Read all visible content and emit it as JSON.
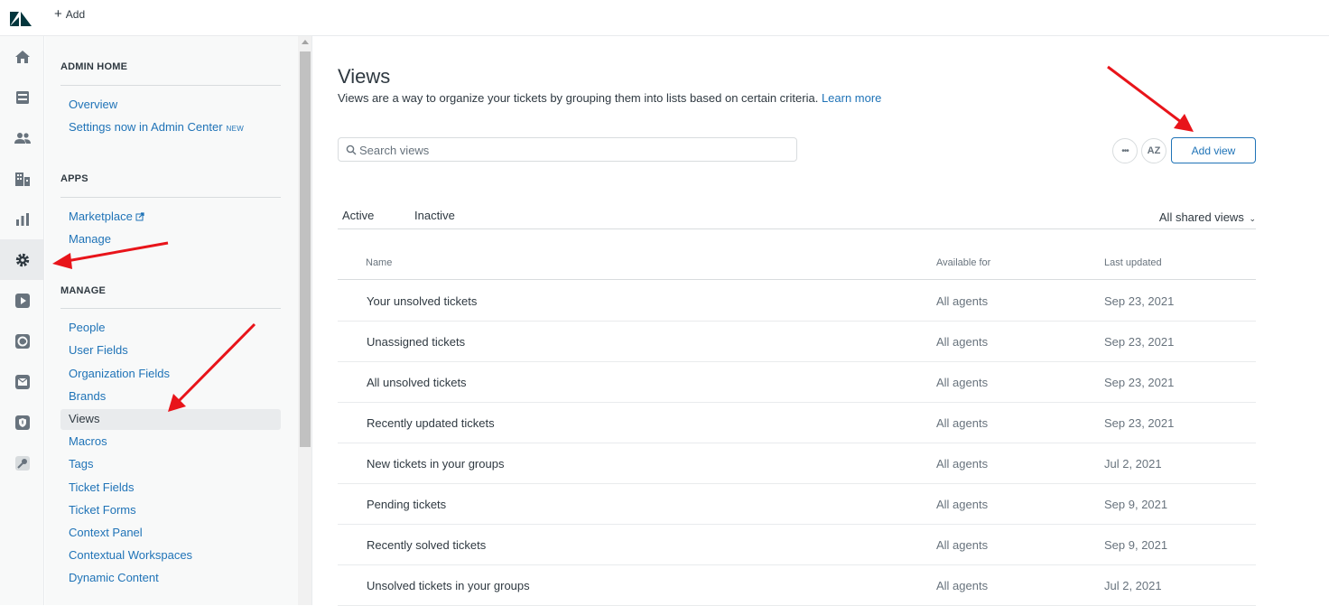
{
  "topbar": {
    "add_label": "Add"
  },
  "rail": {
    "items": [
      {
        "icon": "home-icon"
      },
      {
        "icon": "tickets-icon"
      },
      {
        "icon": "users-icon"
      },
      {
        "icon": "organizations-icon"
      },
      {
        "icon": "reporting-icon"
      },
      {
        "icon": "admin-gear-icon"
      },
      {
        "icon": "video-icon"
      },
      {
        "icon": "app-icon"
      },
      {
        "icon": "mail-app-icon"
      },
      {
        "icon": "shield-app-icon"
      },
      {
        "icon": "tool-app-icon"
      }
    ]
  },
  "sidebar": {
    "admin_home": {
      "title": "ADMIN HOME",
      "links": [
        "Overview",
        "Settings now in Admin Center"
      ],
      "new_badge": "NEW"
    },
    "apps": {
      "title": "APPS",
      "links": [
        "Marketplace",
        "Manage"
      ]
    },
    "manage": {
      "title": "MANAGE",
      "links": [
        "People",
        "User Fields",
        "Organization Fields",
        "Brands",
        "Views",
        "Macros",
        "Tags",
        "Ticket Fields",
        "Ticket Forms",
        "Context Panel",
        "Contextual Workspaces",
        "Dynamic Content"
      ],
      "current": "Views"
    }
  },
  "main": {
    "title": "Views",
    "description": "Views are a way to organize your tickets by grouping them into lists based on certain criteria.",
    "learn_more": "Learn more",
    "search_placeholder": "Search views",
    "more_label": "•••",
    "sort_label": "AZ",
    "add_view_label": "Add view",
    "tabs": [
      "Active",
      "Inactive"
    ],
    "filter_label": "All shared views",
    "columns": [
      "Name",
      "Available for",
      "Last updated"
    ],
    "rows": [
      {
        "name": "Your unsolved tickets",
        "available": "All agents",
        "updated": "Sep 23, 2021"
      },
      {
        "name": "Unassigned tickets",
        "available": "All agents",
        "updated": "Sep 23, 2021"
      },
      {
        "name": "All unsolved tickets",
        "available": "All agents",
        "updated": "Sep 23, 2021"
      },
      {
        "name": "Recently updated tickets",
        "available": "All agents",
        "updated": "Sep 23, 2021"
      },
      {
        "name": "New tickets in your groups",
        "available": "All agents",
        "updated": "Jul 2, 2021"
      },
      {
        "name": "Pending tickets",
        "available": "All agents",
        "updated": "Sep 9, 2021"
      },
      {
        "name": "Recently solved tickets",
        "available": "All agents",
        "updated": "Sep 9, 2021"
      },
      {
        "name": "Unsolved tickets in your groups",
        "available": "All agents",
        "updated": "Jul 2, 2021"
      }
    ]
  },
  "colors": {
    "link": "#1f73b7",
    "text": "#2f3941",
    "muted": "#68737d",
    "annotation_arrow": "#e8141a"
  }
}
